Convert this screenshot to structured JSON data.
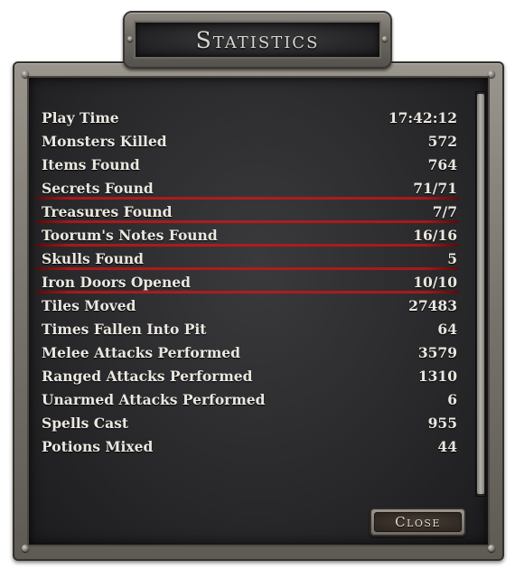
{
  "window": {
    "title": "Statistics"
  },
  "stats": [
    {
      "label": "Play Time",
      "value": "17:42:12",
      "highlight": false
    },
    {
      "label": "Monsters Killed",
      "value": "572",
      "highlight": false
    },
    {
      "label": "Items Found",
      "value": "764",
      "highlight": false
    },
    {
      "label": "Secrets Found",
      "value": "71/71",
      "highlight": true
    },
    {
      "label": "Treasures Found",
      "value": "7/7",
      "highlight": true
    },
    {
      "label": "Toorum's Notes Found",
      "value": "16/16",
      "highlight": true
    },
    {
      "label": "Skulls Found",
      "value": "5",
      "highlight": true
    },
    {
      "label": "Iron Doors Opened",
      "value": "10/10",
      "highlight": true
    },
    {
      "label": "Tiles Moved",
      "value": "27483",
      "highlight": false
    },
    {
      "label": "Times Fallen Into Pit",
      "value": "64",
      "highlight": false
    },
    {
      "label": "Melee Attacks Performed",
      "value": "3579",
      "highlight": false
    },
    {
      "label": "Ranged Attacks Performed",
      "value": "1310",
      "highlight": false
    },
    {
      "label": "Unarmed Attacks Performed",
      "value": "6",
      "highlight": false
    },
    {
      "label": "Spells Cast",
      "value": "955",
      "highlight": false
    },
    {
      "label": "Potions Mixed",
      "value": "44",
      "highlight": false
    }
  ],
  "buttons": {
    "close_label": "Close"
  },
  "colors": {
    "highlight_line": "#b01c1e",
    "text": "#ebe8e1"
  }
}
